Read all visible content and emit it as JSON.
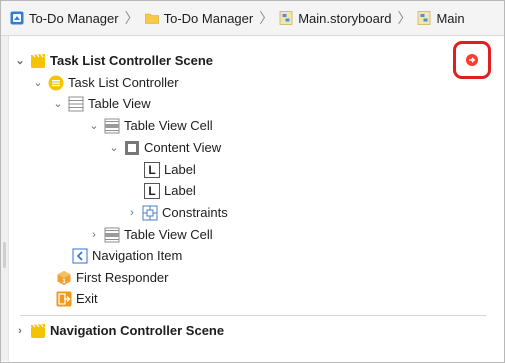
{
  "breadcrumb": {
    "items": [
      {
        "label": "To-Do Manager",
        "icon": "project-icon"
      },
      {
        "label": "To-Do Manager",
        "icon": "folder-icon"
      },
      {
        "label": "Main.storyboard",
        "icon": "storyboard-icon"
      },
      {
        "label": "Main",
        "icon": "storyboard-icon"
      }
    ],
    "separator": "〉"
  },
  "outline": {
    "task_scene": "Task List Controller Scene",
    "task_controller": "Task List Controller",
    "table_view": "Table View",
    "table_view_cell_1": "Table View Cell",
    "content_view": "Content View",
    "label_1": "Label",
    "label_2": "Label",
    "constraints": "Constraints",
    "table_view_cell_2": "Table View Cell",
    "navigation_item": "Navigation Item",
    "first_responder": "First Responder",
    "exit": "Exit",
    "nav_scene": "Navigation Controller Scene"
  },
  "label_glyph": "L",
  "colors": {
    "scene_yellow": "#f5c400",
    "highlight_red": "#e02020",
    "go_button_red": "#ff3b30",
    "folder_yellow": "#f7c948",
    "project_blue": "#2f7fd6",
    "first_responder_orange": "#f0a030",
    "exit_orange": "#f09a1a"
  }
}
